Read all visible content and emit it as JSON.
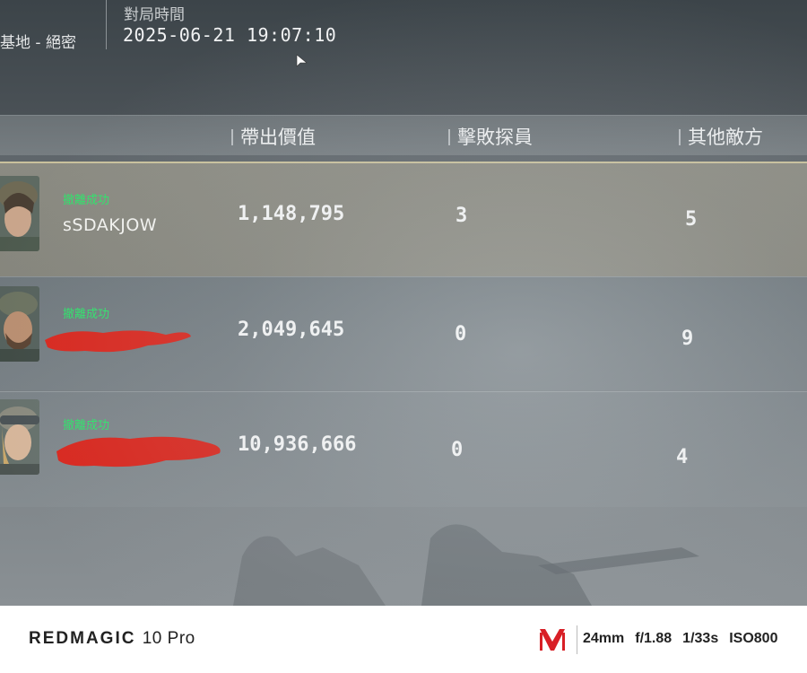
{
  "top": {
    "map_name": "基地 - 絕密",
    "time_label": "對局時間",
    "time_value": "2025-06-21 19:07:10"
  },
  "columns": {
    "value": "帶出價值",
    "kills": "擊敗探員",
    "others": "其他敵方"
  },
  "rows": [
    {
      "status": "撤離成功",
      "name": "sSDAKJOW",
      "value": "1,148,795",
      "kills": "3",
      "others": "5"
    },
    {
      "status": "撤離成功",
      "name": "",
      "value": "2,049,645",
      "kills": "0",
      "others": "9"
    },
    {
      "status": "撤離成功",
      "name": "",
      "value": "10,936,666",
      "kills": "0",
      "others": "4"
    }
  ],
  "footer": {
    "brand": "REDMAGIC",
    "model": "10 Pro",
    "focal": "24mm",
    "aperture": "f/1.88",
    "shutter": "1/33s",
    "iso": "ISO800"
  },
  "colors": {
    "status_green": "#2ee36a",
    "redaction_red": "#d8271e",
    "brand_logo_red": "#d81f26"
  }
}
